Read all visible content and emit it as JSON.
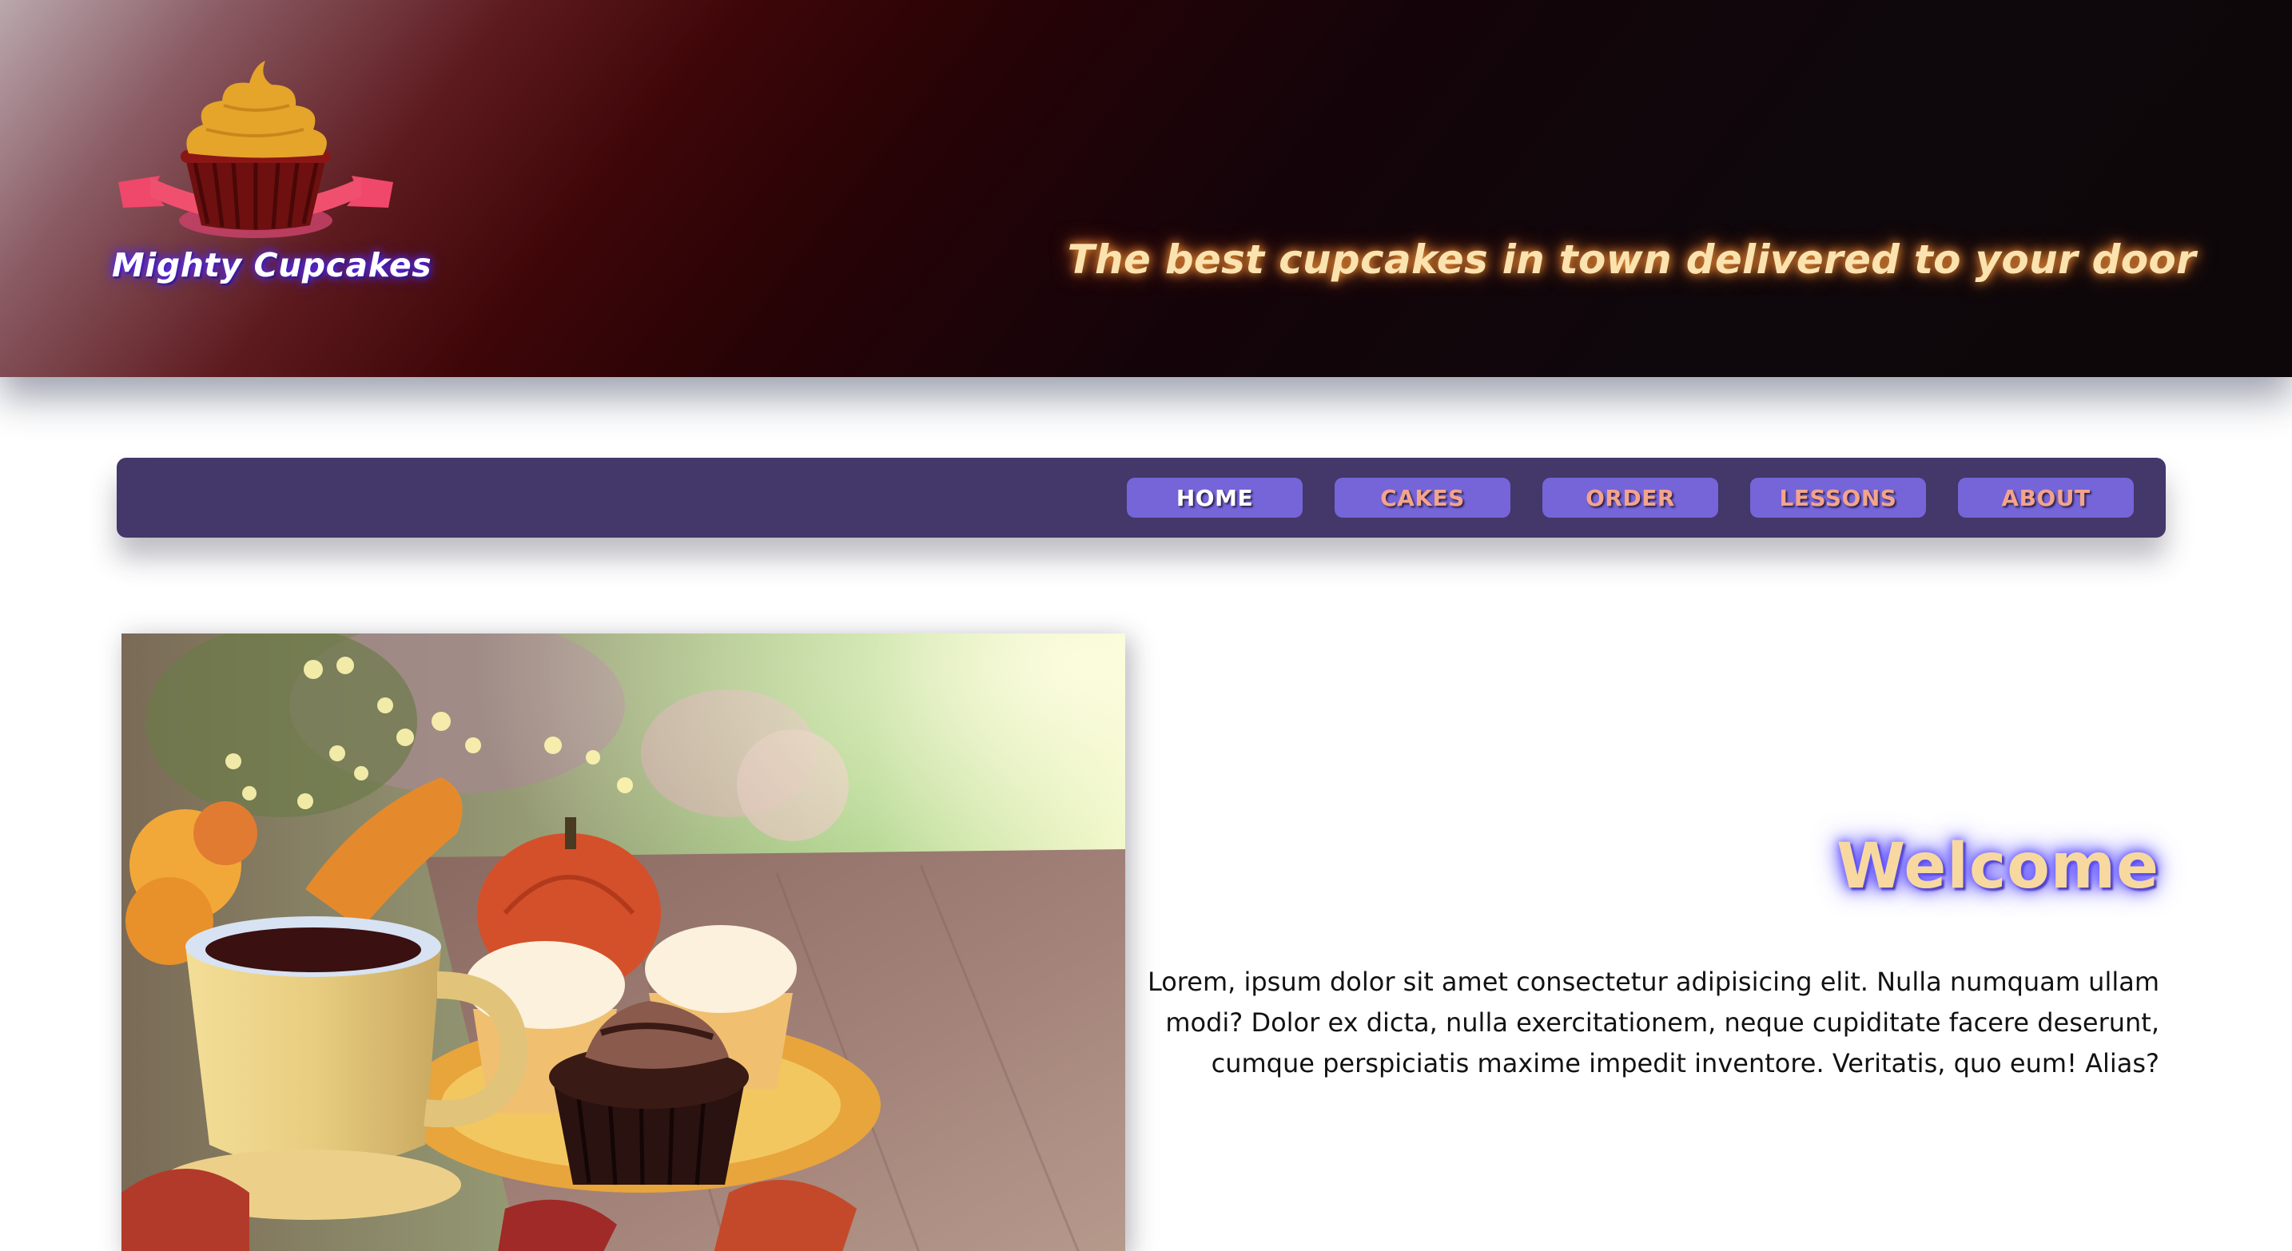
{
  "header": {
    "brand_name": "Mighty Cupcakes",
    "tagline": "The best cupcakes in town delivered to your door",
    "logo_icon": "cupcake-with-ribbon-icon"
  },
  "nav": {
    "items": [
      {
        "label": "HOME",
        "active": true
      },
      {
        "label": "CAKES",
        "active": false
      },
      {
        "label": "ORDER",
        "active": false
      },
      {
        "label": "LESSONS",
        "active": false
      },
      {
        "label": "ABOUT",
        "active": false
      }
    ]
  },
  "main": {
    "heading": "Welcome",
    "body": "Lorem, ipsum dolor sit amet consectetur adipisicing elit. Nulla numquam ullam modi? Dolor ex dicta, nulla exercitationem, neque cupiditate facere deserunt, cumque perspiciatis maxime impedit inventore. Veritatis, quo eum! Alias?",
    "hero_image": "autumn-cupcakes-and-tea-photo"
  },
  "colors": {
    "nav_bg": "#443769",
    "nav_button": "#7565d8",
    "nav_label": "#f2a48c",
    "tagline": "#fbe3b0",
    "heading": "#f7d9a0"
  }
}
